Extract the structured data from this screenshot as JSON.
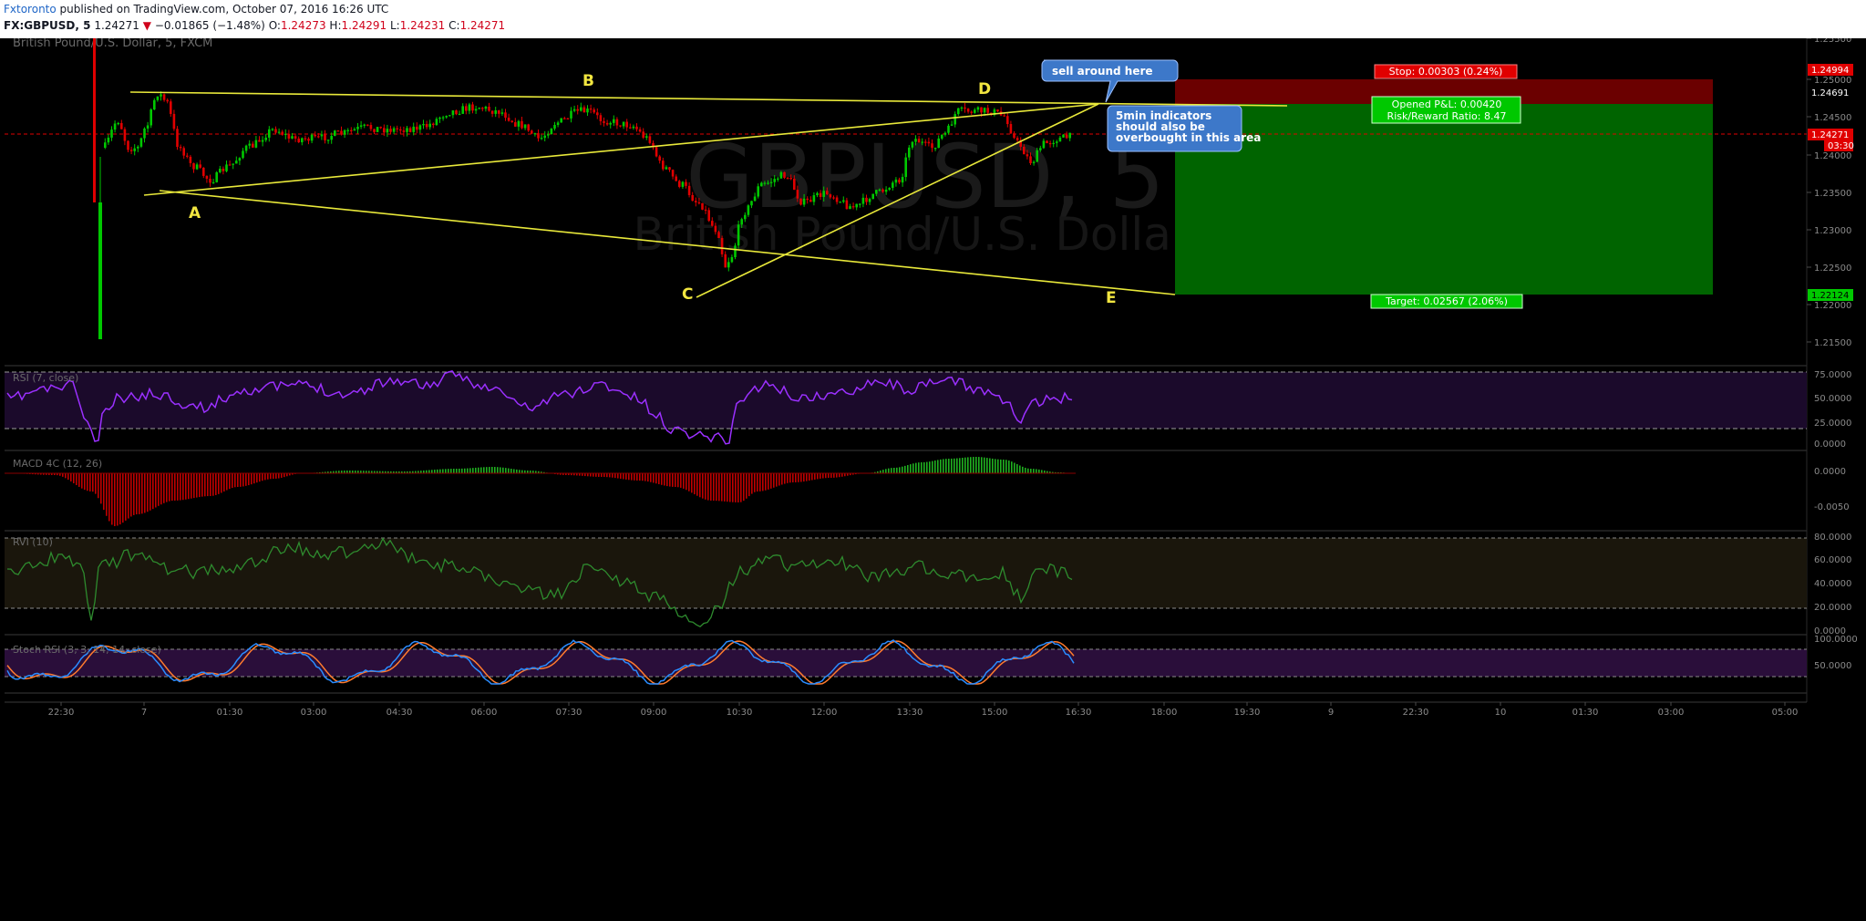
{
  "header": {
    "author": "Fxtoronto",
    "published": "published on TradingView.com, October 07, 2016 16:26 UTC",
    "symbol": "FX:GBPUSD, 5",
    "last": "1.24271",
    "change": "−0.01865 (−1.48%)",
    "o_label": "O:",
    "o_val": "1.24273",
    "h_label": "H:",
    "h_val": "1.24291",
    "l_label": "L:",
    "l_val": "1.24231",
    "c_label": "C:",
    "c_val": "1.24271"
  },
  "chart": {
    "title": "British Pound/U.S. Dollar, 5, FXCM",
    "watermark_big": "GBPUSD, 5",
    "watermark_small": "British Pound/U.S. Dollar",
    "price_ticks": [
      "1.25500",
      "1.25000",
      "1.24500",
      "1.24000",
      "1.23500",
      "1.23000",
      "1.22500",
      "1.22000",
      "1.21500"
    ],
    "price_tags": {
      "stop": "1.24994",
      "entry": "1.24691",
      "last": "1.24271",
      "countdown": "03:30",
      "target": "1.22124"
    },
    "time_ticks": [
      "22:30",
      "7",
      "01:30",
      "03:00",
      "04:30",
      "06:00",
      "07:30",
      "09:00",
      "10:30",
      "12:00",
      "13:30",
      "15:00",
      "16:30",
      "18:00",
      "19:30",
      "9",
      "22:30",
      "10",
      "01:30",
      "03:00",
      "05:00"
    ],
    "points": {
      "a": "A",
      "b": "B",
      "c": "C",
      "d": "D",
      "e": "E"
    },
    "callout_sell": "sell around here",
    "callout_indicators": "5min indicators should also be overbought in this area",
    "stop_label": "Stop: 0.00303 (0.24%)",
    "pnl_label": "Opened P&L: 0.00420",
    "rr_label": "Risk/Reward Ratio: 8.47",
    "target_label": "Target: 0.02567 (2.06%)"
  },
  "panes": {
    "rsi": {
      "title": "RSI (7, close)",
      "ticks": [
        "75.0000",
        "50.0000",
        "25.0000",
        "0.0000"
      ]
    },
    "macd": {
      "title": "MACD 4C (12, 26)",
      "ticks": [
        "0.0000",
        "-0.0050"
      ]
    },
    "rvi": {
      "title": "RVI (10)",
      "ticks": [
        "80.0000",
        "60.0000",
        "40.0000",
        "20.0000",
        "0.0000"
      ]
    },
    "stoch": {
      "title": "Stoch RSI (3, 3, 14, 14, close)",
      "ticks": [
        "100.0000",
        "50.0000"
      ]
    }
  },
  "colors": {
    "bull": "#00c800",
    "bear": "#e00000",
    "trend": "#e8e83a",
    "rsi": "#9b30ff",
    "rvi": "#2e8b2e",
    "stoch_k": "#2a8cff",
    "stoch_d": "#ff7b2e",
    "stop_zone": "#6b0000",
    "target_zone": "#006400",
    "callout": "#3d78c9"
  }
}
